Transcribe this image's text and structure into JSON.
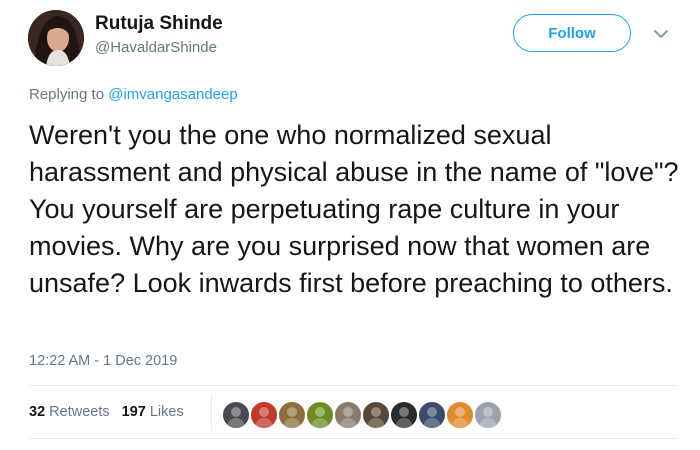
{
  "author": {
    "name": "Rutuja Shinde",
    "handle": "@HavaldarShinde"
  },
  "follow_button": {
    "label": "Follow",
    "accent": "#1da1f2"
  },
  "caret_icon": "chevron-down-icon",
  "replying": {
    "prefix": "Replying to",
    "mention": "@imvangasandeep"
  },
  "tweet": {
    "text": "Weren't you the one who normalized sexual harassment and physical abuse in the name of \"love\"? You yourself are perpetuating rape culture in your movies. Why are you surprised now that women are unsafe? Look inwards first before preaching to others.",
    "timestamp": "12:22 AM - 1 Dec 2019"
  },
  "stats": {
    "retweets_count": "32",
    "retweets_label": "Retweets",
    "likes_count": "197",
    "likes_label": "Likes"
  },
  "liker_avatars": [
    {
      "color": "#4a4a52"
    },
    {
      "color": "#c0392b"
    },
    {
      "color": "#8d6e3a"
    },
    {
      "color": "#6b8e23"
    },
    {
      "color": "#8a7a6a"
    },
    {
      "color": "#5a4636"
    },
    {
      "color": "#2b2b2b"
    },
    {
      "color": "#3b4b6b"
    },
    {
      "color": "#e08a2e"
    },
    {
      "color": "#9aa3ad"
    }
  ],
  "colors": {
    "text_primary": "#14171a",
    "text_secondary": "#657786",
    "link": "#1da1f2",
    "divider": "#e6ecf0"
  }
}
